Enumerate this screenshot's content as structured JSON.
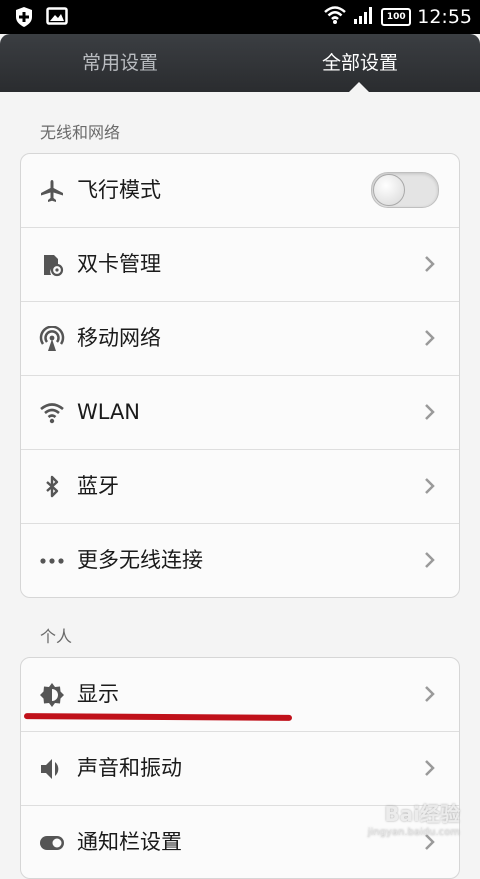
{
  "status_bar": {
    "time": "12:55",
    "battery": "100",
    "icons": [
      "shield-plus-icon",
      "image-icon",
      "wifi-icon",
      "signal-icon",
      "battery-icon"
    ]
  },
  "tabs": [
    {
      "label": "常用设置",
      "active": false
    },
    {
      "label": "全部设置",
      "active": true
    }
  ],
  "sections": {
    "wireless": {
      "title": "无线和网络",
      "items": [
        {
          "label": "飞行模式",
          "icon": "airplane-icon",
          "control": "toggle",
          "toggle_on": false
        },
        {
          "label": "双卡管理",
          "icon": "sim-card-icon",
          "control": "chevron"
        },
        {
          "label": "移动网络",
          "icon": "antenna-icon",
          "control": "chevron"
        },
        {
          "label": "WLAN",
          "icon": "wifi-icon",
          "control": "chevron"
        },
        {
          "label": "蓝牙",
          "icon": "bluetooth-icon",
          "control": "chevron"
        },
        {
          "label": "更多无线连接",
          "icon": "more-icon",
          "control": "chevron"
        }
      ]
    },
    "personal": {
      "title": "个人",
      "items": [
        {
          "label": "显示",
          "icon": "brightness-icon",
          "control": "chevron"
        },
        {
          "label": "声音和振动",
          "icon": "speaker-icon",
          "control": "chevron"
        },
        {
          "label": "通知栏设置",
          "icon": "notification-toggle-icon",
          "control": "chevron"
        }
      ]
    }
  },
  "colors": {
    "annotation_underline": "#c0111a",
    "tab_bar": "#2f3236",
    "background": "#f4f4f4"
  },
  "watermark": {
    "main": "Bai经验",
    "sub": "jingyan.baidu.com"
  }
}
